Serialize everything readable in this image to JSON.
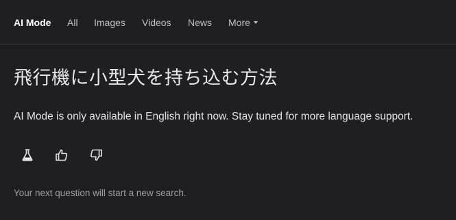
{
  "nav": {
    "tabs": [
      {
        "label": "AI Mode",
        "active": true
      },
      {
        "label": "All"
      },
      {
        "label": "Images"
      },
      {
        "label": "Videos"
      },
      {
        "label": "News"
      },
      {
        "label": "More"
      }
    ]
  },
  "main": {
    "query": "飛行機に小型犬を持ち込む方法",
    "notice": "AI Mode is only available in English right now. Stay tuned for more language support.",
    "actions": [
      {
        "icon": "flask-icon"
      },
      {
        "icon": "thumbs-up-icon"
      },
      {
        "icon": "thumbs-down-icon"
      }
    ],
    "footer": "Your next question will start a new search."
  },
  "colors": {
    "background": "#1f1f23",
    "text": "#e8e8ea",
    "muted": "#9aa0a6",
    "divider": "#3a3a3f"
  }
}
